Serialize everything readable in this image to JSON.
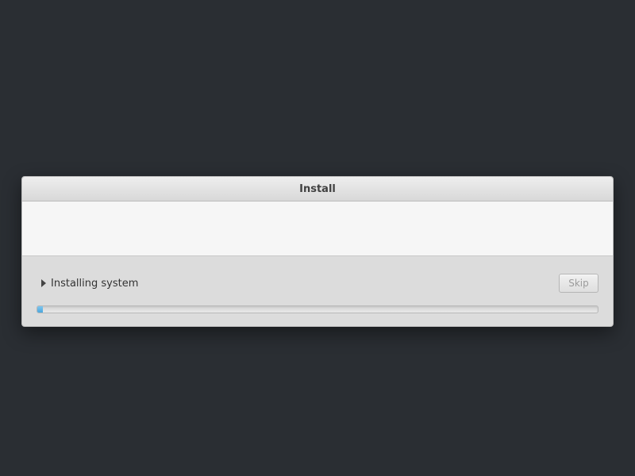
{
  "dialog": {
    "title": "Install"
  },
  "status": {
    "text": "Installing system",
    "skip_label": "Skip",
    "progress_percent": 1
  },
  "colors": {
    "accent": "#4aa6dc",
    "background": "#2a2e33"
  }
}
